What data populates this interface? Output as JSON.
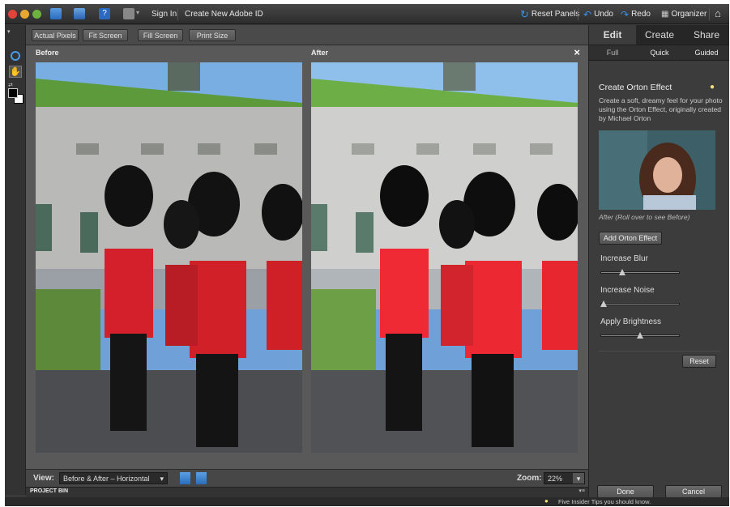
{
  "topbar": {
    "sign_in": "Sign In",
    "create_id": "Create New Adobe ID",
    "reset_panels": "Reset Panels",
    "undo": "Undo",
    "redo": "Redo",
    "organizer": "Organizer"
  },
  "options": {
    "actual_pixels": "Actual Pixels",
    "fit_screen": "Fit Screen",
    "fill_screen": "Fill Screen",
    "print_size": "Print Size"
  },
  "canvas": {
    "before_label": "Before",
    "after_label": "After",
    "close": "×"
  },
  "viewbar": {
    "view_label": "View:",
    "view_value": "Before & After – Horizontal",
    "zoom_label": "Zoom:",
    "zoom_value": "22%"
  },
  "bin": {
    "label": "PROJECT BIN"
  },
  "status": {
    "tip": "Five Insider Tips you should know."
  },
  "panel": {
    "tabs": [
      "Edit",
      "Create",
      "Share"
    ],
    "subtabs": [
      "Full",
      "Quick",
      "Guided"
    ],
    "title": "Create Orton Effect",
    "description": "Create a soft, dreamy feel for your photo using the Orton Effect, originally created by Michael Orton",
    "preview_caption": "After (Roll over to see Before)",
    "add_button": "Add Orton Effect",
    "sliders": [
      {
        "label": "Increase Blur",
        "value": 0.25
      },
      {
        "label": "Increase Noise",
        "value": 0.0
      },
      {
        "label": "Apply Brightness",
        "value": 0.5
      }
    ],
    "reset": "Reset",
    "done": "Done",
    "cancel": "Cancel"
  },
  "colors": {
    "accent": "#2f7fd0",
    "tab_active": "#3c3c3c"
  }
}
